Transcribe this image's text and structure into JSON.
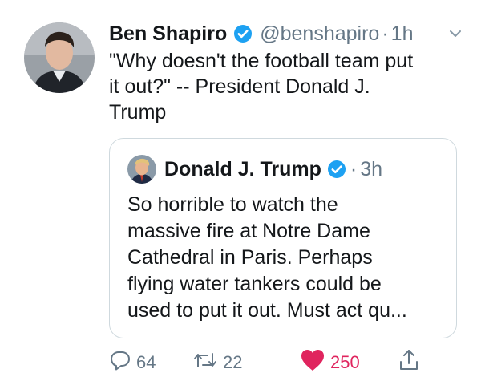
{
  "tweet": {
    "author_name": "Ben Shapiro",
    "handle": "@benshapiro",
    "separator": "·",
    "time": "1h",
    "text_lines": [
      "\"Why doesn't the football team put",
      "it out?\" -- President Donald J.",
      "Trump"
    ]
  },
  "quoted_tweet": {
    "author_name": "Donald J. Trump",
    "separator": "·",
    "time": "3h",
    "text_lines": [
      "So horrible to watch the",
      "massive fire at Notre Dame",
      "Cathedral in Paris. Perhaps",
      "flying water tankers could be",
      "used to put it out. Must act qu..."
    ]
  },
  "actions": {
    "replies": "64",
    "retweets": "22",
    "likes": "250"
  },
  "icons": {
    "verified": "verified-badge-icon",
    "menu": "chevron-down-icon",
    "reply": "reply-bubble-icon",
    "retweet": "retweet-icon",
    "like": "heart-filled-icon",
    "share": "share-upload-icon"
  },
  "colors": {
    "verified_blue": "#1da1f2",
    "secondary_text": "#657786",
    "like_red": "#e0245e",
    "border": "#cfd9de"
  }
}
